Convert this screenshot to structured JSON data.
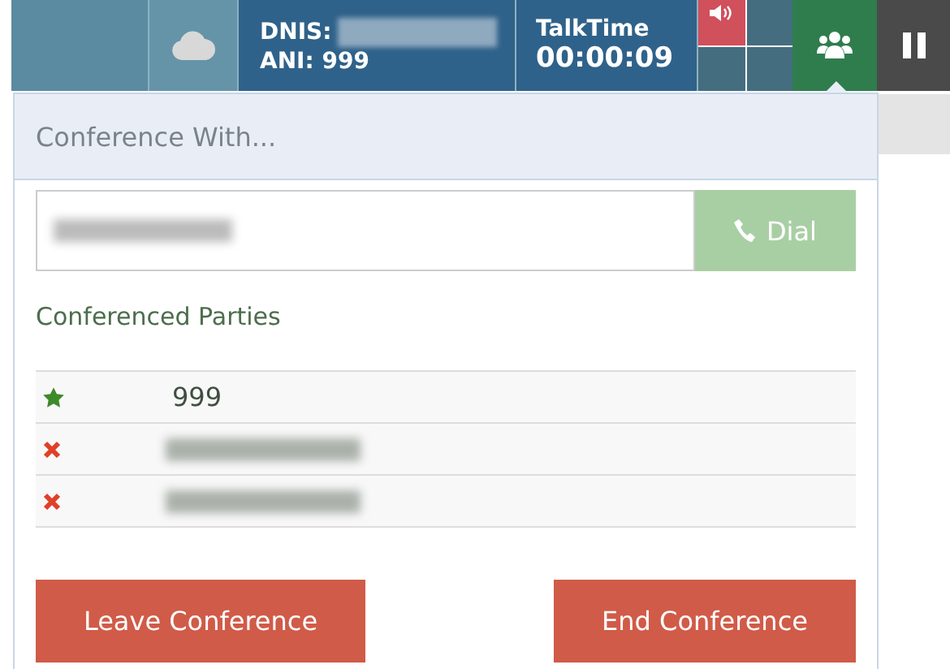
{
  "top_bar": {
    "dnis_label": "DNIS:",
    "ani": "ANI: 999",
    "talktime_label": "TalkTime",
    "talktime": "00:00:09"
  },
  "conference": {
    "title": "Conference With...",
    "dial_button": "Dial",
    "parties_heading": "Conferenced Parties",
    "parties": [
      {
        "kind": "host",
        "number": "999"
      },
      {
        "kind": "removable"
      },
      {
        "kind": "removable"
      }
    ],
    "buttons": [
      "Leave Conference",
      "End Conference"
    ]
  }
}
